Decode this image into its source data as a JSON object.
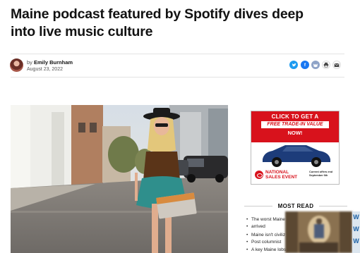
{
  "article": {
    "headline": "Maine podcast featured by Spotify dives deep into live music culture",
    "byline_prefix": "by",
    "author": "Emily Burnham",
    "date": "August 23, 2022"
  },
  "share_buttons": [
    {
      "icon": "twitter-icon",
      "color": "#1d9bf0"
    },
    {
      "icon": "facebook-icon",
      "color": "#1877f2"
    },
    {
      "icon": "reddit-icon",
      "color": "#8ea3c7"
    },
    {
      "icon": "print-icon",
      "color": "#444444"
    },
    {
      "icon": "email-icon",
      "color": "#444444"
    }
  ],
  "ad": {
    "line1": "CLICK TO GET A",
    "line2": "FREE TRADE-IN VALUE",
    "line3": "NOW!",
    "event_line1": "NATIONAL",
    "event_line2": "SALES EVENT",
    "offer_line1": "Current offers end",
    "offer_line2": "September 6th",
    "accent": "#d8121c"
  },
  "most_read": {
    "title": "MOST READ",
    "items": [
      {
        "text": "The worst Maine"
      },
      {
        "text": "arrived"
      },
      {
        "text": "Maine isn't civiliz"
      },
      {
        "text": "Post columnist"
      },
      {
        "text": "A key Maine lobs"
      }
    ]
  },
  "edge_letters": [
    "W",
    "W",
    "W"
  ]
}
